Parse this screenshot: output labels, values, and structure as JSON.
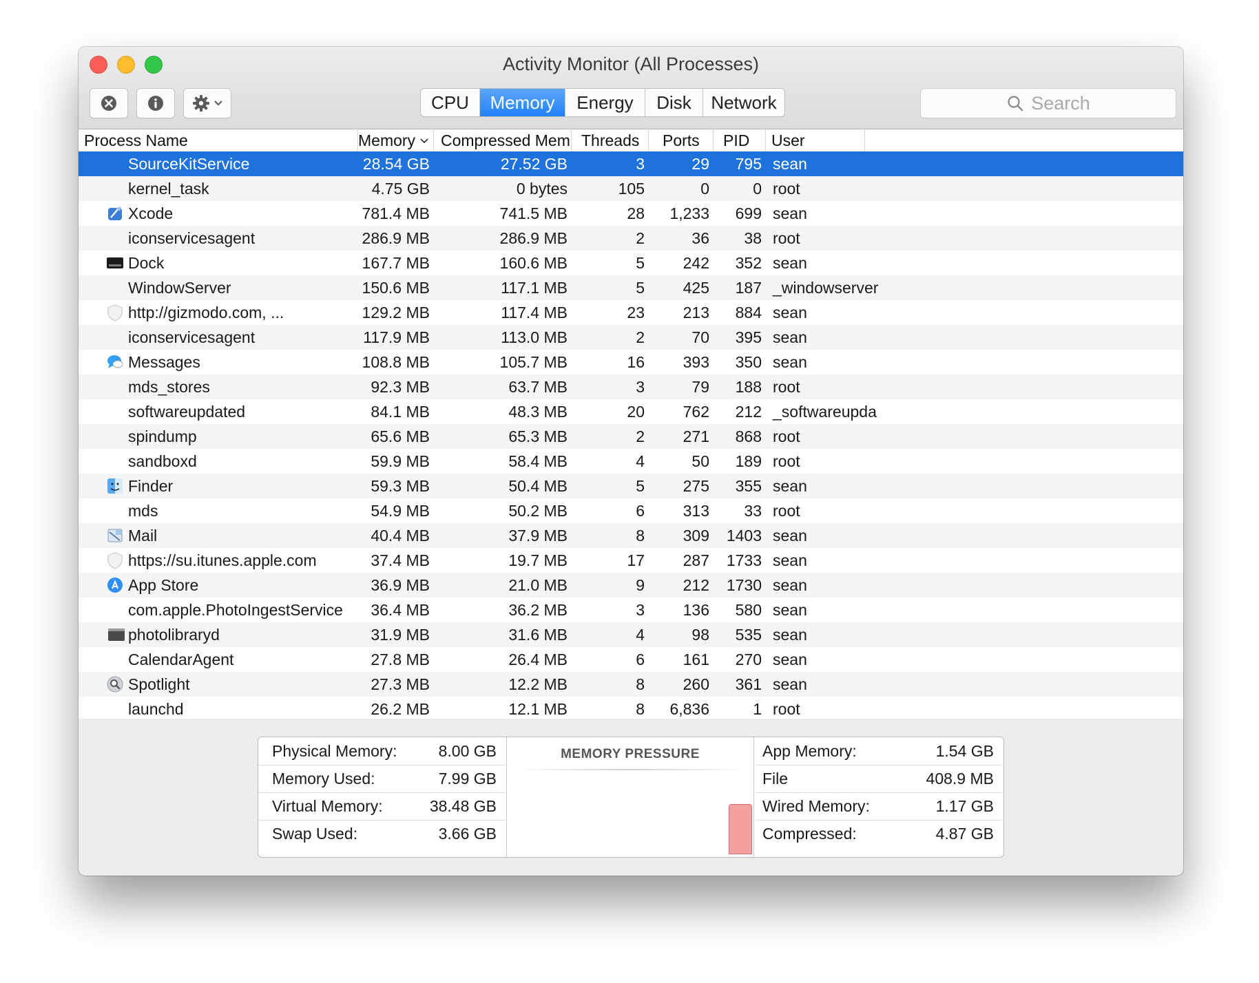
{
  "window": {
    "title": "Activity Monitor (All Processes)"
  },
  "tabs": [
    {
      "label": "CPU",
      "active": false
    },
    {
      "label": "Memory",
      "active": true
    },
    {
      "label": "Energy",
      "active": false
    },
    {
      "label": "Disk",
      "active": false
    },
    {
      "label": "Network",
      "active": false
    }
  ],
  "search": {
    "placeholder": "Search"
  },
  "columns": {
    "process": "Process Name",
    "memory": "Memory",
    "compressed": "Compressed Mem",
    "threads": "Threads",
    "ports": "Ports",
    "pid": "PID",
    "user": "User"
  },
  "processes": [
    {
      "name": "SourceKitService",
      "memory": "28.54 GB",
      "compressed": "27.52 GB",
      "threads": "3",
      "ports": "29",
      "pid": "795",
      "user": "sean",
      "icon": "none",
      "selected": true
    },
    {
      "name": "kernel_task",
      "memory": "4.75 GB",
      "compressed": "0 bytes",
      "threads": "105",
      "ports": "0",
      "pid": "0",
      "user": "root",
      "icon": "none"
    },
    {
      "name": "Xcode",
      "memory": "781.4 MB",
      "compressed": "741.5 MB",
      "threads": "28",
      "ports": "1,233",
      "pid": "699",
      "user": "sean",
      "icon": "xcode-icon"
    },
    {
      "name": "iconservicesagent",
      "memory": "286.9 MB",
      "compressed": "286.9 MB",
      "threads": "2",
      "ports": "36",
      "pid": "38",
      "user": "root",
      "icon": "none"
    },
    {
      "name": "Dock",
      "memory": "167.7 MB",
      "compressed": "160.6 MB",
      "threads": "5",
      "ports": "242",
      "pid": "352",
      "user": "sean",
      "icon": "dock-icon"
    },
    {
      "name": "WindowServer",
      "memory": "150.6 MB",
      "compressed": "117.1 MB",
      "threads": "5",
      "ports": "425",
      "pid": "187",
      "user": "_windowserver",
      "icon": "none"
    },
    {
      "name": "http://gizmodo.com, ...",
      "memory": "129.2 MB",
      "compressed": "117.4 MB",
      "threads": "23",
      "ports": "213",
      "pid": "884",
      "user": "sean",
      "icon": "web-content-shield-icon"
    },
    {
      "name": "iconservicesagent",
      "memory": "117.9 MB",
      "compressed": "113.0 MB",
      "threads": "2",
      "ports": "70",
      "pid": "395",
      "user": "sean",
      "icon": "none"
    },
    {
      "name": "Messages",
      "memory": "108.8 MB",
      "compressed": "105.7 MB",
      "threads": "16",
      "ports": "393",
      "pid": "350",
      "user": "sean",
      "icon": "messages-icon"
    },
    {
      "name": "mds_stores",
      "memory": "92.3 MB",
      "compressed": "63.7 MB",
      "threads": "3",
      "ports": "79",
      "pid": "188",
      "user": "root",
      "icon": "none"
    },
    {
      "name": "softwareupdated",
      "memory": "84.1 MB",
      "compressed": "48.3 MB",
      "threads": "20",
      "ports": "762",
      "pid": "212",
      "user": "_softwareupda",
      "icon": "none"
    },
    {
      "name": "spindump",
      "memory": "65.6 MB",
      "compressed": "65.3 MB",
      "threads": "2",
      "ports": "271",
      "pid": "868",
      "user": "root",
      "icon": "none"
    },
    {
      "name": "sandboxd",
      "memory": "59.9 MB",
      "compressed": "58.4 MB",
      "threads": "4",
      "ports": "50",
      "pid": "189",
      "user": "root",
      "icon": "none"
    },
    {
      "name": "Finder",
      "memory": "59.3 MB",
      "compressed": "50.4 MB",
      "threads": "5",
      "ports": "275",
      "pid": "355",
      "user": "sean",
      "icon": "finder-icon"
    },
    {
      "name": "mds",
      "memory": "54.9 MB",
      "compressed": "50.2 MB",
      "threads": "6",
      "ports": "313",
      "pid": "33",
      "user": "root",
      "icon": "none"
    },
    {
      "name": "Mail",
      "memory": "40.4 MB",
      "compressed": "37.9 MB",
      "threads": "8",
      "ports": "309",
      "pid": "1403",
      "user": "sean",
      "icon": "mail-icon"
    },
    {
      "name": "https://su.itunes.apple.com",
      "memory": "37.4 MB",
      "compressed": "19.7 MB",
      "threads": "17",
      "ports": "287",
      "pid": "1733",
      "user": "sean",
      "icon": "web-content-shield-icon"
    },
    {
      "name": "App Store",
      "memory": "36.9 MB",
      "compressed": "21.0 MB",
      "threads": "9",
      "ports": "212",
      "pid": "1730",
      "user": "sean",
      "icon": "app-store-icon"
    },
    {
      "name": "com.apple.PhotoIngestService",
      "memory": "36.4 MB",
      "compressed": "36.2 MB",
      "threads": "3",
      "ports": "136",
      "pid": "580",
      "user": "sean",
      "icon": "none"
    },
    {
      "name": "photolibraryd",
      "memory": "31.9 MB",
      "compressed": "31.6 MB",
      "threads": "4",
      "ports": "98",
      "pid": "535",
      "user": "sean",
      "icon": "terminal-exec-icon"
    },
    {
      "name": "CalendarAgent",
      "memory": "27.8 MB",
      "compressed": "26.4 MB",
      "threads": "6",
      "ports": "161",
      "pid": "270",
      "user": "sean",
      "icon": "none"
    },
    {
      "name": "Spotlight",
      "memory": "27.3 MB",
      "compressed": "12.2 MB",
      "threads": "8",
      "ports": "260",
      "pid": "361",
      "user": "sean",
      "icon": "spotlight-icon"
    },
    {
      "name": "launchd",
      "memory": "26.2 MB",
      "compressed": "12.1 MB",
      "threads": "8",
      "ports": "6,836",
      "pid": "1",
      "user": "root",
      "icon": "none"
    }
  ],
  "memory_stats_left": [
    {
      "label": "Physical Memory:",
      "value": "8.00 GB"
    },
    {
      "label": "Memory Used:",
      "value": "7.99 GB"
    },
    {
      "label": "Virtual Memory:",
      "value": "38.48 GB"
    },
    {
      "label": "Swap Used:",
      "value": "3.66 GB"
    }
  ],
  "memory_pressure": {
    "title": "MEMORY PRESSURE",
    "level": 0.62,
    "color": "#f6a1a1"
  },
  "memory_stats_right": [
    {
      "label": "App Memory:",
      "value": "1.54 GB"
    },
    {
      "label": "File",
      "value": "408.9 MB"
    },
    {
      "label": "Wired Memory:",
      "value": "1.17 GB"
    },
    {
      "label": "Compressed:",
      "value": "4.87 GB"
    }
  ],
  "colors": {
    "selection": "#1e72dc",
    "active_tab": "#2382f7"
  }
}
